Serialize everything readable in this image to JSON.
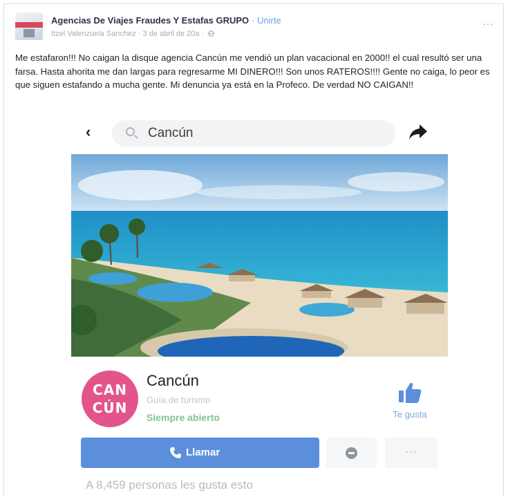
{
  "post": {
    "group_name": "Agencias De Viajes Fraudes Y Estafas GRUPO",
    "join_label": "· Unirte",
    "meta": "Itzel Valenzuela Sanchez · 3 de abril de 20a ·",
    "more_label": "···",
    "text": "Me estafaron!!! No caigan la disque agencia Cancún me vendió un plan vacacional en 2000!! el cual resultó ser una farsa. Hasta ahorita me dan largas para regresarme MI DINERO!!! Son unos RATEROS!!!! Gente no caiga, lo peor es que siguen estafando a mucha gente. Mi denuncia ya está en la Profeco. De verdad NO CAIGAN!!"
  },
  "screenshot": {
    "back_glyph": "‹",
    "search_value": "Cancún",
    "page": {
      "avatar_line1": "CAN",
      "avatar_line2": "CÚN",
      "avatar_color": "#e3558a",
      "name": "Cancún",
      "category": "Guía de turismo",
      "hours_status": "Siempre abierto",
      "like_label": "Te gusta",
      "call_label": "Llamar",
      "dots_label": "···",
      "likes_count": "A 8,459 personas les gusta esto"
    },
    "colors": {
      "call_button": "#5b8fdb",
      "open_status": "#84c391",
      "link": "#6d9de4"
    }
  }
}
